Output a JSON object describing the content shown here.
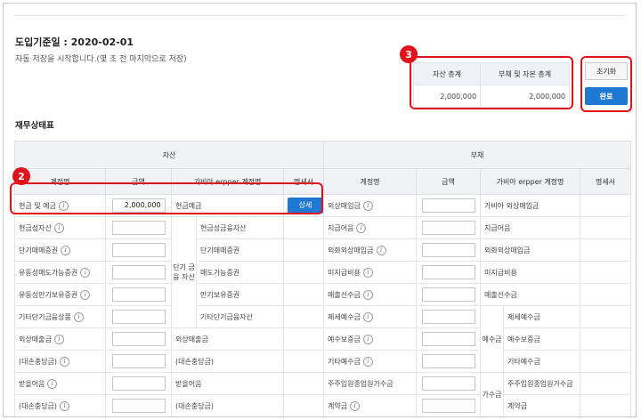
{
  "intro": {
    "title": "도입기준일 : 2020-02-01",
    "desc": "자동 저장을 시작합니다.(몇 초 전 마지막으로 저장)"
  },
  "summary": {
    "col1": "자산 총계",
    "col2": "부채 및 자본 총계",
    "val1": "2,000,000",
    "val2": "2,000,000"
  },
  "buttons": {
    "reset": "초기화",
    "done": "완료"
  },
  "badges": {
    "summary": "3",
    "row": "2"
  },
  "section_title": "재무상태표",
  "table": {
    "asset_group": "자산",
    "liability_group": "부채",
    "headers": {
      "account": "계정명",
      "amount": "금액",
      "erpper": "가비아 erpper 계정명",
      "detail": "명세서"
    },
    "detail_button": "상세",
    "asset_cat": "단기 금융 자산",
    "liab_cat1": "예수금",
    "liab_cat2": "가수금",
    "rows": [
      {
        "a_name": "현금 및 예금",
        "a_val": "2,000,000",
        "a_erp": "현금예금",
        "a_sub": "",
        "l_name": "외상매입금",
        "l_erp": "가비아 외상매입금"
      },
      {
        "a_name": "현금성자산",
        "a_val": "",
        "a_erp": "",
        "a_sub": "현금성금융자산",
        "l_name": "지급어음",
        "l_erp": "지급어음"
      },
      {
        "a_name": "단기매매증권",
        "a_val": "",
        "a_erp": "",
        "a_sub": "단기매매증권",
        "l_name": "외화외상매입금",
        "l_erp": "외화외상매입금"
      },
      {
        "a_name": "유동성매도가능증권",
        "a_val": "",
        "a_erp": "",
        "a_sub": "매도가능증권",
        "l_name": "미지급비용",
        "l_erp": "미지급비용"
      },
      {
        "a_name": "유동성만기보유증권",
        "a_val": "",
        "a_erp": "",
        "a_sub": "만기보유증권",
        "l_name": "매출선수금",
        "l_erp": "매출선수금"
      },
      {
        "a_name": "기타단기금융상품",
        "a_val": "",
        "a_erp": "",
        "a_sub": "기타단기금융자산",
        "l_name": "제세예수금",
        "l_erp": "제세예수금"
      },
      {
        "a_name": "외상매출금",
        "a_val": "",
        "a_erp": "외상매출금",
        "a_sub": "",
        "l_name": "예수보증금",
        "l_erp": "예수보증금"
      },
      {
        "a_name": "(대손충당금)",
        "a_val": "",
        "a_erp": "(대손충당금)",
        "a_sub": "",
        "l_name": "기타예수금",
        "l_erp": "기타예수금"
      },
      {
        "a_name": "받을어음",
        "a_val": "",
        "a_erp": "받을어음",
        "a_sub": "",
        "l_name": "주주임원종업원가수금",
        "l_erp": "주주임원종업원가수금"
      },
      {
        "a_name": "(대손충당금)",
        "a_val": "",
        "a_erp": "(대손충당금)",
        "a_sub": "",
        "l_name": "계약금",
        "l_erp": "계약금"
      }
    ]
  }
}
